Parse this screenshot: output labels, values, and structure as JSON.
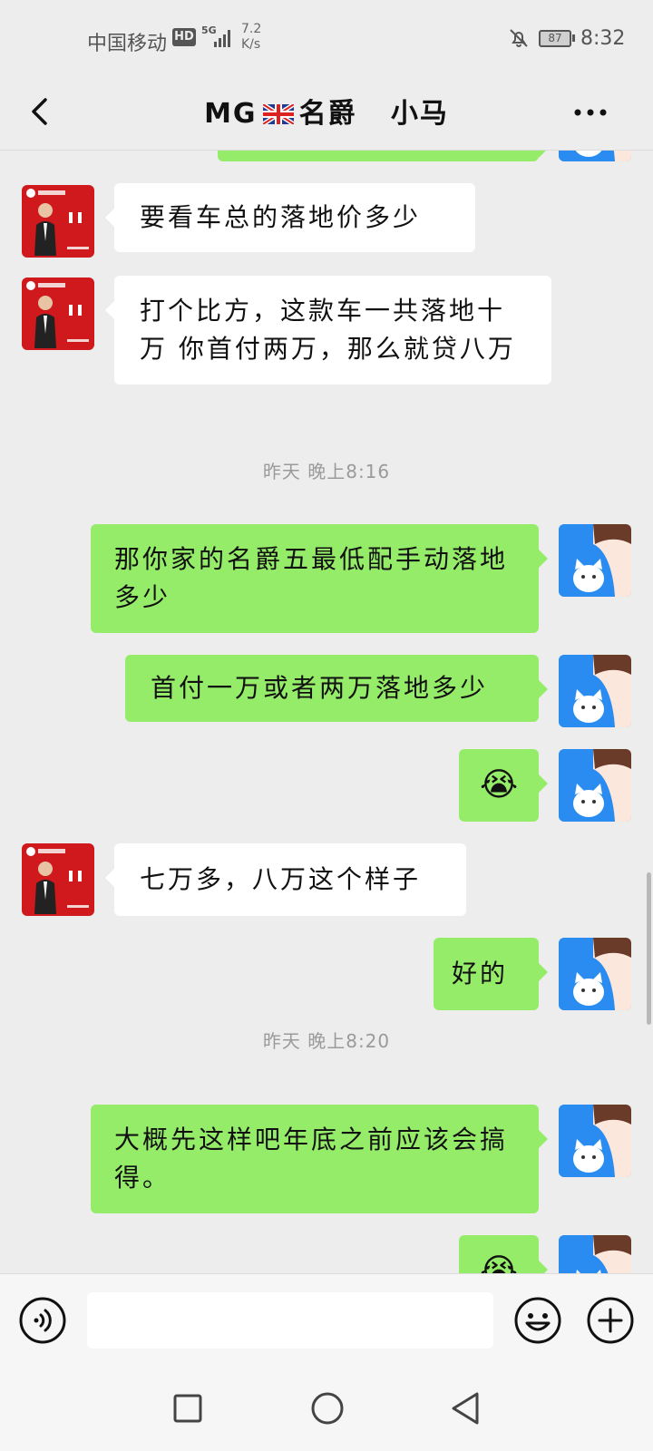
{
  "status_bar": {
    "carrier": "中国移动",
    "hd": "HD",
    "network": "5G",
    "speed_value": "7.2",
    "speed_unit": "K/s",
    "battery": "87",
    "time": "8:32"
  },
  "header": {
    "title_prefix": "MG",
    "title_suffix": "名爵   小马"
  },
  "messages": [
    {
      "side": "left",
      "text": "要看车总的落地价多少"
    },
    {
      "side": "left",
      "text": "打个比方，这款车一共落地十万  你首付两万，那么就贷八万"
    },
    {
      "timestamp": "昨天 晚上8:16"
    },
    {
      "side": "right",
      "text": "那你家的名爵五最低配手动落地多少"
    },
    {
      "side": "right",
      "text": "首付一万或者两万落地多少"
    },
    {
      "side": "right",
      "emoji": "😭"
    },
    {
      "side": "left",
      "text": "七万多，八万这个样子"
    },
    {
      "side": "right",
      "text": "好的"
    },
    {
      "timestamp": "昨天 晚上8:20"
    },
    {
      "side": "right",
      "text": "大概先这样吧年底之前应该会搞得。"
    },
    {
      "side": "right",
      "emoji": "😭"
    }
  ],
  "input": {
    "value": "",
    "placeholder": ""
  },
  "colors": {
    "background": "#ededed",
    "sent_bubble": "#95ec69",
    "received_bubble": "#ffffff",
    "avatar_red": "#d0191c",
    "avatar_blue": "#2a8cf0"
  },
  "icons": {
    "back": "chevron-left-icon",
    "more": "ellipsis-icon",
    "voice": "voice-icon",
    "emoji": "smiley-icon",
    "plus": "plus-icon"
  }
}
